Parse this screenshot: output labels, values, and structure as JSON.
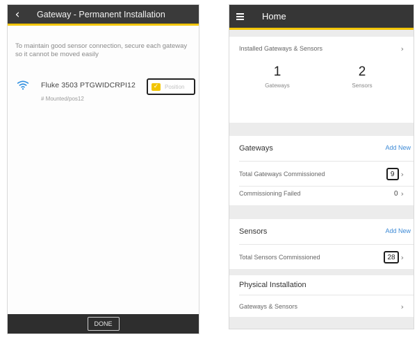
{
  "left": {
    "header": {
      "back_icon": "chevron-left-icon",
      "title": "Gateway - Permanent Installation"
    },
    "instruction": "To maintain good sensor connection, secure each gateway so it cannot be moved easily",
    "device": {
      "wifi_icon": "wifi-icon",
      "name": "Fluke 3503 PTGWIDCRPI12",
      "status": "# Mounted/pos12",
      "position_label": "Position"
    },
    "footer": {
      "done_label": "DONE"
    }
  },
  "right": {
    "header": {
      "menu_icon": "hamburger-menu-icon",
      "title": "Home"
    },
    "installed": {
      "label": "Installed Gateways & Sensors",
      "gateways_count": "1",
      "gateways_label": "Gateways",
      "sensors_count": "2",
      "sensors_label": "Sensors"
    },
    "gateways": {
      "title": "Gateways",
      "add_new": "Add New",
      "total_label": "Total Gateways Commissioned",
      "total_value": "9",
      "failed_label": "Commissioning Failed",
      "failed_value": "0"
    },
    "sensors": {
      "title": "Sensors",
      "add_new": "Add New",
      "total_label": "Total Sensors Commissioned",
      "total_value": "28"
    },
    "physical": {
      "title": "Physical Installation",
      "row_label": "Gateways & Sensors"
    },
    "accent_color": "#f2c500",
    "link_color": "#3d8ad6"
  }
}
